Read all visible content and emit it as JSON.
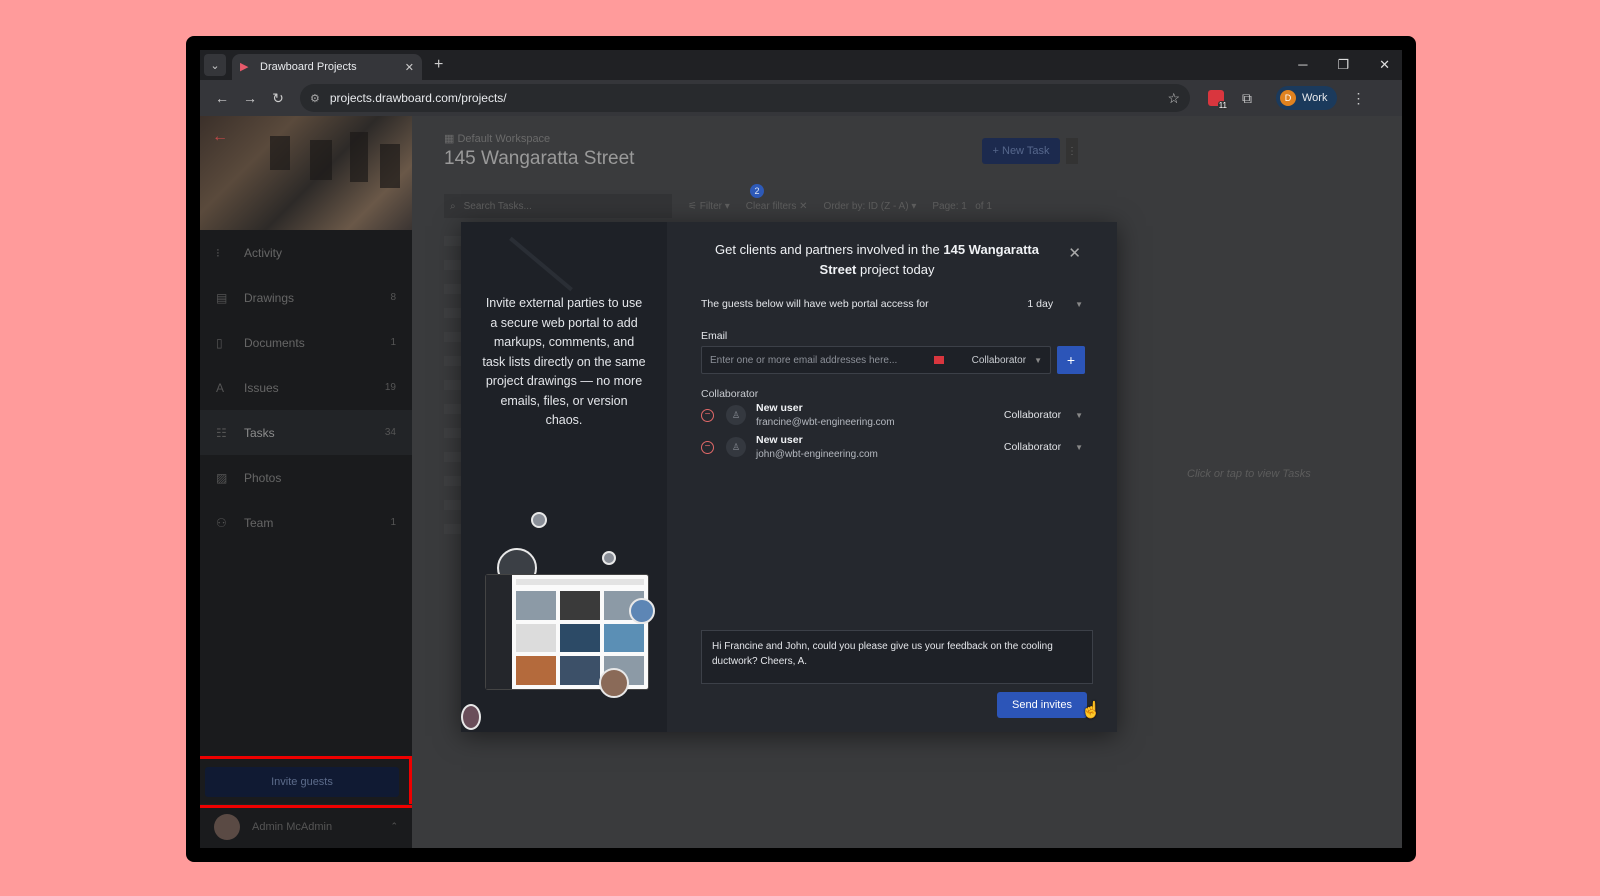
{
  "browser": {
    "tab_title": "Drawboard Projects",
    "url": "projects.drawboard.com/projects/",
    "profile_initial": "D",
    "profile_label": "Work",
    "extension_badge": "11"
  },
  "sidebar": {
    "items": [
      {
        "label": "Activity",
        "count": ""
      },
      {
        "label": "Drawings",
        "count": "8"
      },
      {
        "label": "Documents",
        "count": "1"
      },
      {
        "label": "Issues",
        "count": "19"
      },
      {
        "label": "Tasks",
        "count": "34"
      },
      {
        "label": "Photos",
        "count": ""
      },
      {
        "label": "Team",
        "count": "1"
      }
    ],
    "invite_label": "Invite guests",
    "user_name": "Admin McAdmin"
  },
  "main": {
    "workspace": "Default Workspace",
    "title": "145 Wangaratta Street",
    "new_task_label": "+ New Task",
    "search_placeholder": "Search Tasks...",
    "filter_label": "Filter",
    "filter_count": "2",
    "clear_filters_label": "Clear filters",
    "order_label": "Order by: ID (Z - A)",
    "page_label": "Page:",
    "page_value": "1",
    "page_of": "of 1",
    "right_hint": "Click or tap to view Tasks"
  },
  "modal": {
    "left_text": "Invite external parties to use a secure web portal to add markups, comments, and task lists directly on the same project drawings — no more emails, files, or version chaos.",
    "heading_prefix": "Get clients and partners involved in the",
    "heading_project": "145 Wangaratta Street",
    "heading_suffix": "project today",
    "access_text": "The guests below will have web portal access for",
    "access_duration": "1 day",
    "email_label": "Email",
    "email_placeholder": "Enter one or more email addresses here...",
    "email_role": "Collaborator",
    "group_label": "Collaborator",
    "guests": [
      {
        "name": "New user",
        "email": "francine@wbt-engineering.com",
        "role": "Collaborator"
      },
      {
        "name": "New user",
        "email": "john@wbt-engineering.com",
        "role": "Collaborator"
      }
    ],
    "message": "Hi Francine and John, could you please give us your feedback on the cooling ductwork? Cheers, A.",
    "send_label": "Send invites"
  }
}
